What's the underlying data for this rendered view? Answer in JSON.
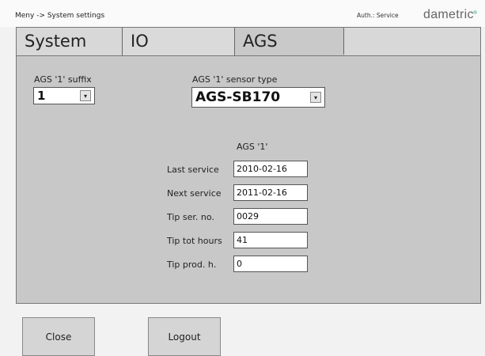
{
  "header": {
    "breadcrumb": "Meny -> System settings",
    "auth": "Auth.: Service",
    "brand": "dametric"
  },
  "tabs": [
    {
      "label": "System"
    },
    {
      "label": "IO"
    },
    {
      "label": "AGS",
      "active": true
    },
    {
      "label": ""
    }
  ],
  "ags": {
    "suffix_label": "AGS '1' suffix",
    "suffix_value": "1",
    "sensor_type_label": "AGS '1' sensor type",
    "sensor_type_value": "AGS-SB170",
    "column_header": "AGS '1'",
    "fields": [
      {
        "label": "Last service",
        "value": "2010-02-16"
      },
      {
        "label": "Next service",
        "value": "2011-02-16"
      },
      {
        "label": "Tip ser. no.",
        "value": "0029"
      },
      {
        "label": "Tip tot hours",
        "value": "41"
      },
      {
        "label": "Tip prod. h.",
        "value": "0"
      }
    ]
  },
  "buttons": {
    "close": "Close",
    "logout": "Logout"
  },
  "colors": {
    "panel": "#c8c8c8",
    "brand_dot": "#a8dcc8"
  }
}
